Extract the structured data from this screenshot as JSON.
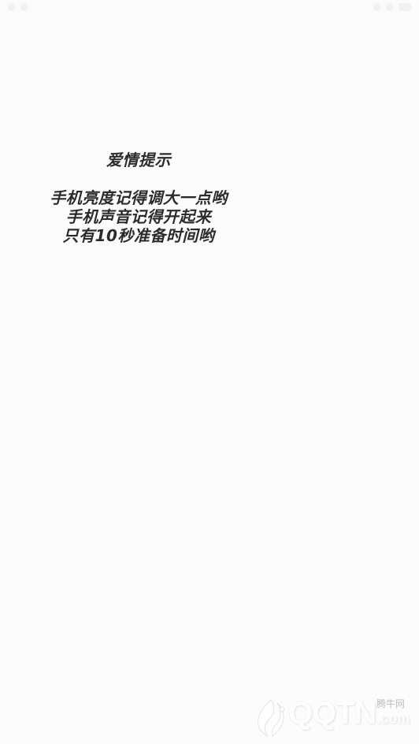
{
  "tip": {
    "title": "爱情提示",
    "lines": [
      "手机亮度记得调大一点哟",
      "手机声音记得开起来",
      "只有10秒准备时间哟"
    ]
  },
  "watermark": {
    "cn": "腾牛网",
    "logo_text": "QQTN",
    "logo_suffix": ".com",
    "logo_icon": "qqtn-logo-icon"
  }
}
